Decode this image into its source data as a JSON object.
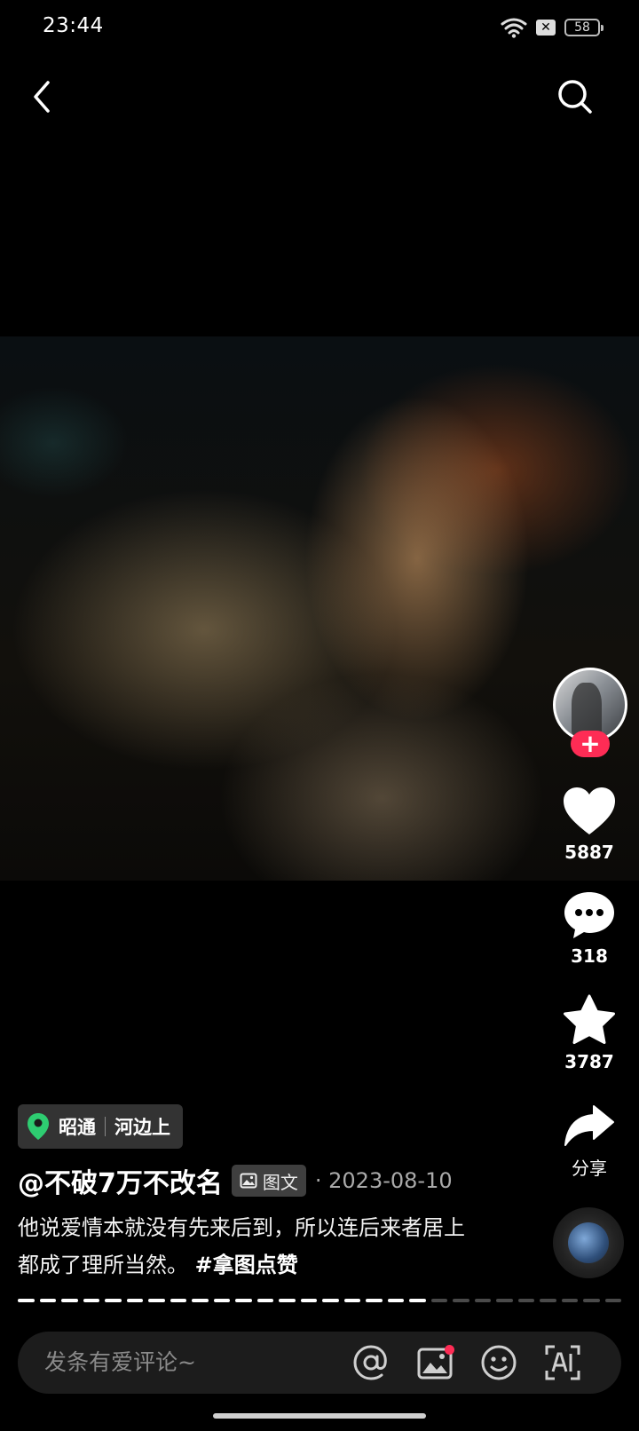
{
  "status_bar": {
    "time": "23:44",
    "battery": "58"
  },
  "location": {
    "city": "昭通",
    "place": "河边上"
  },
  "post": {
    "author": "@不破7万不改名",
    "type_badge": "图文",
    "date": "· 2023-08-10",
    "caption": "他说爱情本就没有先来后到，所以连后来者居上都成了理所当然。",
    "hashtag": "#拿图点赞"
  },
  "actions": {
    "likes": "5887",
    "comments": "318",
    "favorites": "3787",
    "share_label": "分享"
  },
  "comment_bar": {
    "placeholder": "发条有爱评论~"
  },
  "progress": {
    "total_segments": 28,
    "seen_segments": 19
  },
  "colors": {
    "accent": "#fe2c55",
    "location_pin": "#2ecc71"
  }
}
